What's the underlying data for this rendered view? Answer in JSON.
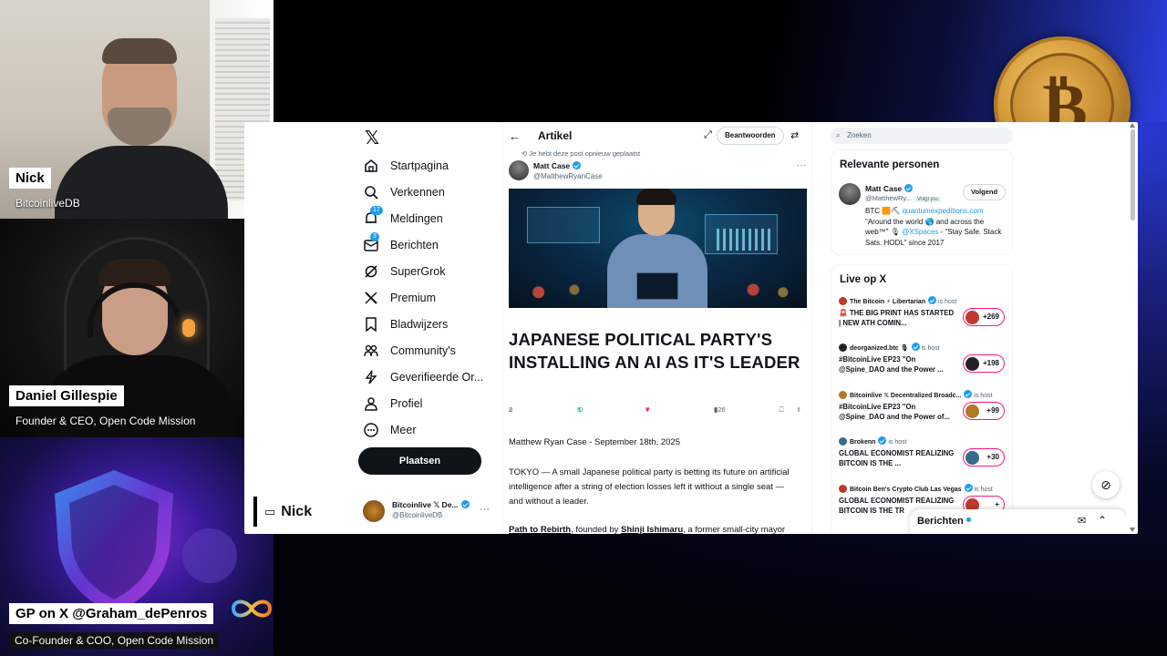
{
  "stream": {
    "cam1": {
      "name": "Nick",
      "role": "BitcoinliveDB"
    },
    "cam2": {
      "name": "Daniel Gillespie",
      "role": "Founder & CEO, Open Code Mission"
    },
    "cam3": {
      "name": "GP on X @Graham_dePenros",
      "role": "Co-Founder & COO, Open Code Mission"
    },
    "screen_share_label": "Nick",
    "coin_symbol": "₿"
  },
  "x": {
    "logo": "𝕏",
    "nav": [
      {
        "label": "Startpagina",
        "icon": "home-icon"
      },
      {
        "label": "Verkennen",
        "icon": "search-icon"
      },
      {
        "label": "Meldingen",
        "icon": "bell-icon",
        "badge": "17"
      },
      {
        "label": "Berichten",
        "icon": "mail-icon",
        "badge": "3"
      },
      {
        "label": "SuperGrok",
        "icon": "grok-icon"
      },
      {
        "label": "Premium",
        "icon": "x-premium-icon"
      },
      {
        "label": "Bladwijzers",
        "icon": "bookmark-icon"
      },
      {
        "label": "Community's",
        "icon": "people-icon"
      },
      {
        "label": "Geverifieerde Or...",
        "icon": "lightning-icon"
      },
      {
        "label": "Profiel",
        "icon": "person-icon"
      },
      {
        "label": "Meer",
        "icon": "more-circle-icon"
      }
    ],
    "post_button": "Plaatsen",
    "account": {
      "name": "Bitcoinlive 𝕏 De...",
      "handle": "@BitcoinliveDB"
    },
    "article": {
      "header_title": "Artikel",
      "reply_button": "Beantwoorden",
      "repost_note": "Je hebt deze post opnieuw geplaatst",
      "author_name": "Matt Case",
      "author_handle": "@MatthewRyanCase",
      "title": "JAPANESE POLITICAL PARTY'S INSTALLING AN AI AS IT'S LEADER",
      "stats": {
        "replies": "2",
        "reposts": "5",
        "likes": "7",
        "views": "626"
      },
      "byline": "Matthew Ryan Case - September 18th, 2025",
      "para1": "TOKYO  — A small Japanese political party is betting its future on artificial intelligence after a string of election losses left it without a single seat — and without a leader.",
      "para2_lead": "Path to Rebirth",
      "para2_mid": ", founded by ",
      "para2_name": "Shinji Ishimaru",
      "para2_tail": ", a former small-city mayor"
    },
    "search_placeholder": "Zoeken",
    "relevant": {
      "title": "Relevante personen",
      "name": "Matt Case",
      "handle": "@MatthewRy...",
      "follows_you": "Volgt jou",
      "button": "Volgend",
      "bio_1": "BTC 🟧⛏ ",
      "bio_link": "quantumexpeditions.com",
      "bio_2": "\"Around the world 🌎 and across the web™\" 🎙 ",
      "bio_link2": "@XSpaces",
      "bio_3": " - \"Stay Safe. Stack Sats. HODL\" since 2017"
    },
    "live": {
      "title": "Live op X",
      "is_host": "is host",
      "spaces": [
        {
          "host": "The Bitcoin ⚡ Libertarian",
          "title": "🚨 THE BIG PRINT HAS STARTED | NEW ATH COMIN...",
          "count": "+269",
          "color": "#c0392b"
        },
        {
          "host": "deorganized.btc 🎙",
          "title": "#BitcoinLive EP23 \"On @Spine_DAO and the Power ...",
          "count": "+198",
          "color": "#222222"
        },
        {
          "host": "Bitcoinlive 𝕏 Decentralized Broadc...",
          "title": "#BitcoinLive EP23 \"On @Spine_DAO and the Power of...",
          "count": "+99",
          "color": "#b07a28"
        },
        {
          "host": "Brokenn",
          "title": "GLOBAL ECONOMIST REALIZING BITCOIN IS THE ...",
          "count": "+30",
          "color": "#3a6a8a"
        },
        {
          "host": "Bitcoin Ben's Crypto Club Las Vegas",
          "title": "GLOBAL ECONOMIST REALIZING BITCOIN IS THE TR",
          "count": "+",
          "color": "#c0392b"
        }
      ]
    },
    "messages_bar": "Berichten"
  }
}
